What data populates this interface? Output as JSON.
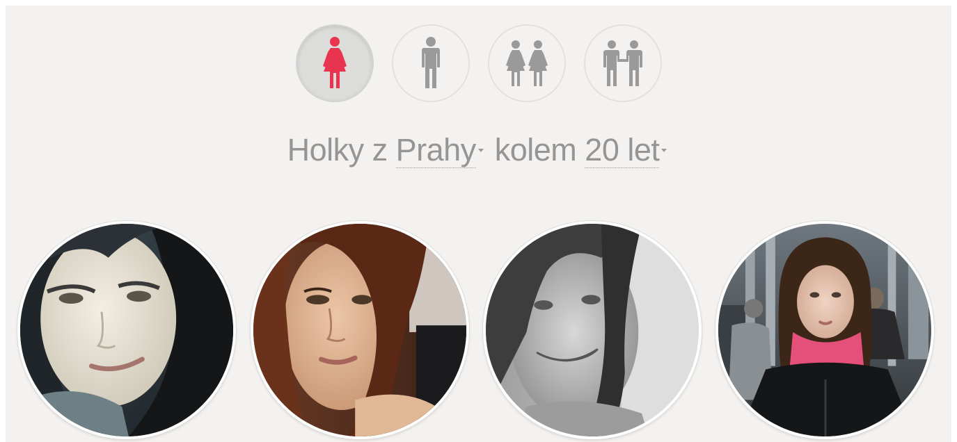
{
  "filters": [
    {
      "name": "female",
      "icon": "female-icon",
      "active": true
    },
    {
      "name": "male",
      "icon": "male-icon",
      "active": false
    },
    {
      "name": "female-couple",
      "icon": "female-couple-icon",
      "active": false
    },
    {
      "name": "male-couple",
      "icon": "male-couple-icon",
      "active": false
    }
  ],
  "headline": {
    "prefix": "Holky z",
    "city": "Prahy",
    "middle": "kolem",
    "age": "20 let"
  },
  "profiles": [
    {
      "photo": "profile-photo-1"
    },
    {
      "photo": "profile-photo-2"
    },
    {
      "photo": "profile-photo-3"
    },
    {
      "photo": "profile-photo-4"
    }
  ],
  "colors": {
    "panel": "#f3f2f1",
    "active_icon": "#e8344f",
    "icon": "#9a9a9a",
    "text": "#959595"
  }
}
